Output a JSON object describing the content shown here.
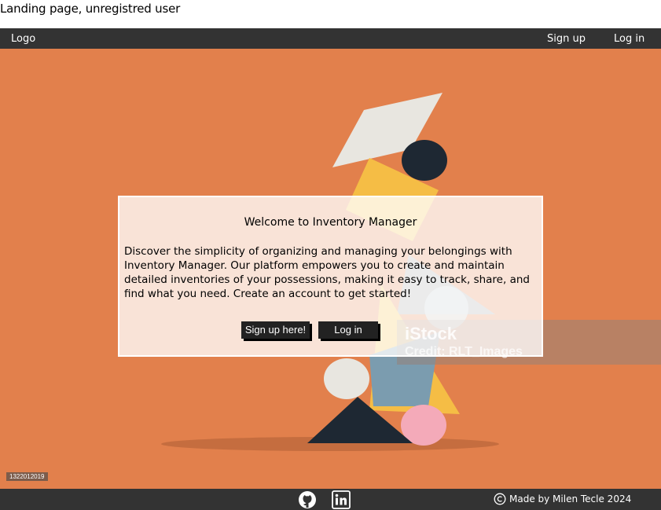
{
  "page": {
    "caption": "Landing page, unregistred user"
  },
  "navbar": {
    "logo": "Logo",
    "signup": "Sign up",
    "login": "Log in"
  },
  "hero": {
    "watermark_logo": "iStock",
    "watermark_credit": "Credit: RLT_Images",
    "image_id": "1322012019"
  },
  "welcome": {
    "title": "Welcome to Inventory Manager",
    "text": "Discover the simplicity of organizing and managing your belongings with Inventory Manager. Our platform empowers you to create and maintain detailed inventories of your possessions, making it easy to track, share, and find what you need. Create an account to get started!",
    "signup_button": "Sign up here!",
    "login_button": "Log in"
  },
  "footer": {
    "credit": "Made by Milen Tecle 2024",
    "icons": [
      "github-icon",
      "linkedin-icon",
      "copyright-icon"
    ]
  },
  "colors": {
    "navbar": "#333333",
    "hero_background": "#e2804c",
    "button": "#222222"
  }
}
